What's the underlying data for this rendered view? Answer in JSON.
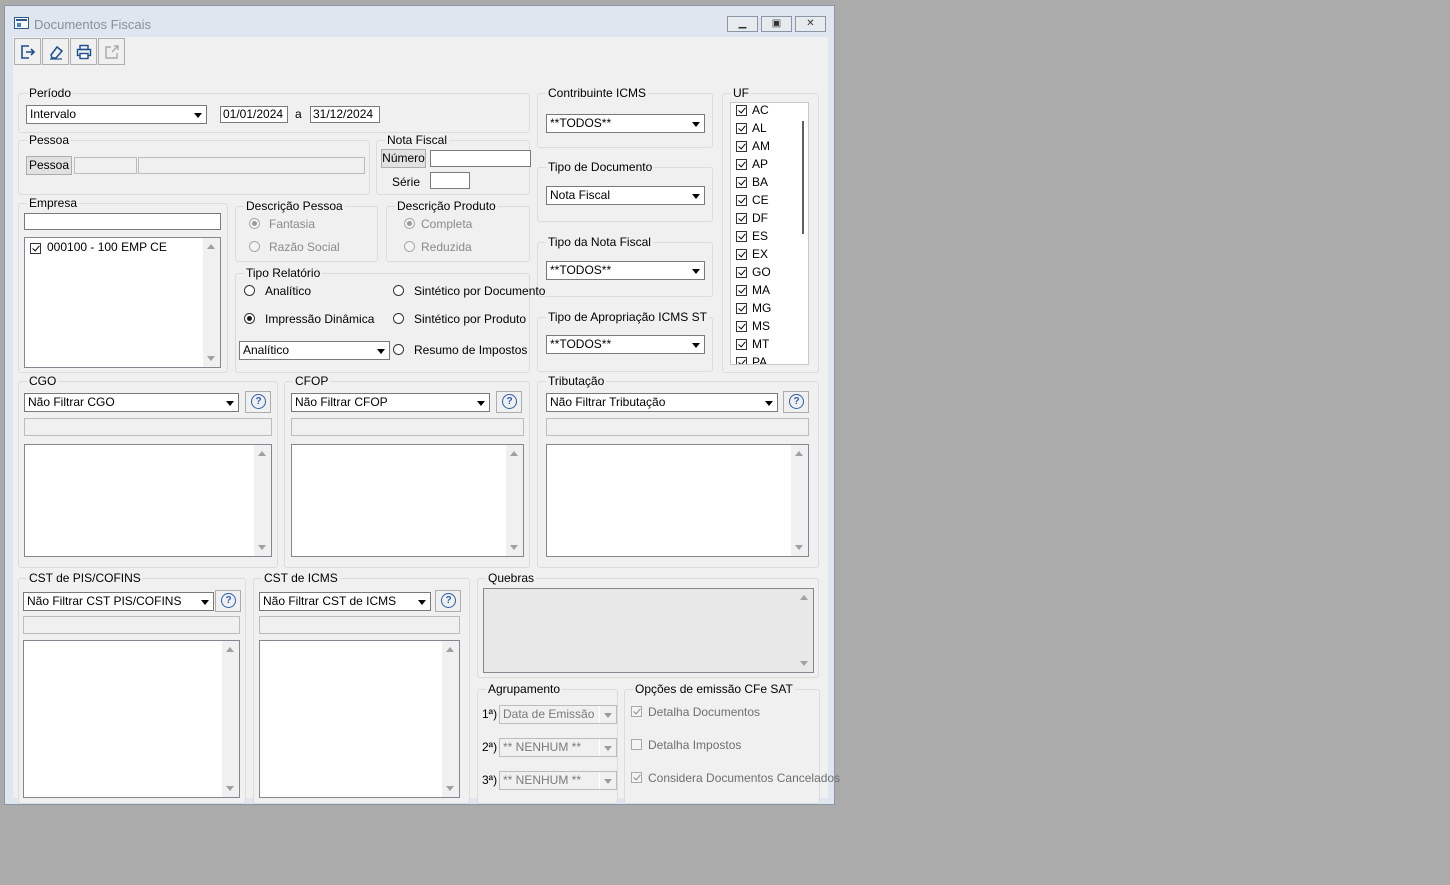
{
  "window": {
    "title": "Documentos Fiscais"
  },
  "periodo": {
    "title": "Período",
    "mode": "Intervalo",
    "date_from": "01/01/2024",
    "between": "a",
    "date_to": "31/12/2024"
  },
  "pessoa": {
    "title": "Pessoa",
    "button": "Pessoa",
    "code": "",
    "name": ""
  },
  "nota_fiscal": {
    "title": "Nota Fiscal",
    "numero_label": "Número",
    "numero": "",
    "serie_label": "Série",
    "serie": ""
  },
  "contribuinte": {
    "title": "Contribuinte ICMS",
    "value": "**TODOS**"
  },
  "tipo_documento": {
    "title": "Tipo de Documento",
    "value": "Nota Fiscal"
  },
  "tipo_nota": {
    "title": "Tipo da Nota Fiscal",
    "value": "**TODOS**"
  },
  "tipo_apropriacao": {
    "title": "Tipo de Apropriação ICMS ST",
    "value": "**TODOS**"
  },
  "uf": {
    "title": "UF",
    "items": [
      {
        "code": "AC",
        "checked": true
      },
      {
        "code": "AL",
        "checked": true
      },
      {
        "code": "AM",
        "checked": true
      },
      {
        "code": "AP",
        "checked": true
      },
      {
        "code": "BA",
        "checked": true
      },
      {
        "code": "CE",
        "checked": true
      },
      {
        "code": "DF",
        "checked": true
      },
      {
        "code": "ES",
        "checked": true
      },
      {
        "code": "EX",
        "checked": true
      },
      {
        "code": "GO",
        "checked": true
      },
      {
        "code": "MA",
        "checked": true
      },
      {
        "code": "MG",
        "checked": true
      },
      {
        "code": "MS",
        "checked": true
      },
      {
        "code": "MT",
        "checked": true
      },
      {
        "code": "PA",
        "checked": true
      }
    ]
  },
  "empresa": {
    "title": "Empresa",
    "search": "",
    "items": [
      {
        "label": "000100 - 100 EMP CE",
        "checked": true
      }
    ]
  },
  "descricao_pessoa": {
    "title": "Descrição Pessoa",
    "opt1": "Fantasia",
    "opt2": "Razão Social"
  },
  "descricao_produto": {
    "title": "Descrição Produto",
    "opt1": "Completa",
    "opt2": "Reduzida"
  },
  "tipo_relatorio": {
    "title": "Tipo Relatório",
    "analitico": "Analítico",
    "impressao_dinamica": "Impressão Dinâmica",
    "sintetico_documento": "Sintético por Documento",
    "sintetico_produto": "Sintético por Produto",
    "resumo_impostos": "Resumo de Impostos",
    "combo_value": "Analítico"
  },
  "cgo": {
    "title": "CGO",
    "value": "Não Filtrar CGO"
  },
  "cfop": {
    "title": "CFOP",
    "value": "Não Filtrar CFOP"
  },
  "tributacao": {
    "title": "Tributação",
    "value": "Não Filtrar Tributação"
  },
  "cst_pis": {
    "title": "CST de PIS/COFINS",
    "value": "Não Filtrar CST PIS/COFINS"
  },
  "cst_icms": {
    "title": "CST de ICMS",
    "value": "Não Filtrar CST de ICMS"
  },
  "quebras": {
    "title": "Quebras"
  },
  "agrupamento": {
    "title": "Agrupamento",
    "l1": "1ª)",
    "v1": "Data de Emissão",
    "l2": "2ª)",
    "v2": "** NENHUM **",
    "l3": "3ª)",
    "v3": "** NENHUM **"
  },
  "cfe_sat": {
    "title": "Opções de emissão CFe SAT",
    "detalha_documentos": "Detalha Documentos",
    "detalha_impostos": "Detalha Impostos",
    "considera_cancelados": "Considera Documentos Cancelados"
  },
  "colors": {
    "background": "#ababab",
    "panel": "#f0f0f0",
    "accent": "#2a5db0"
  }
}
